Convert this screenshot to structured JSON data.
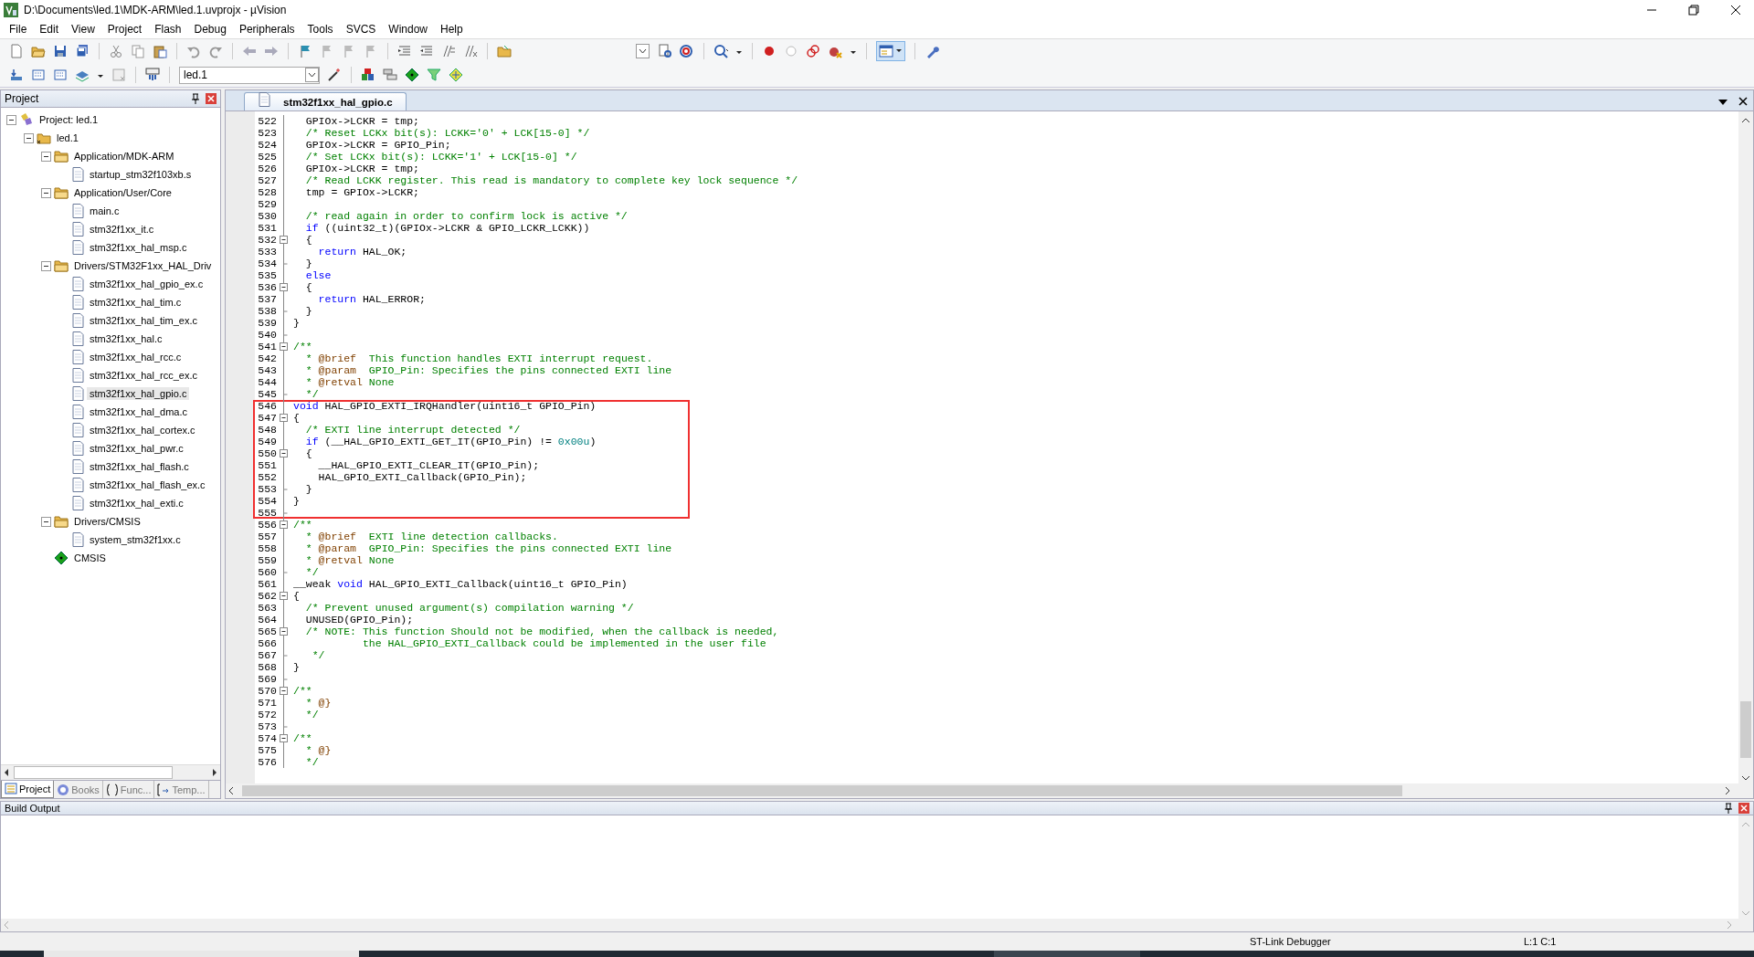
{
  "window": {
    "title": "D:\\Documents\\led.1\\MDK-ARM\\led.1.uvprojx - µVision"
  },
  "menu": [
    "File",
    "Edit",
    "View",
    "Project",
    "Flash",
    "Debug",
    "Peripherals",
    "Tools",
    "SVCS",
    "Window",
    "Help"
  ],
  "target_toolbar": {
    "target": "led.1"
  },
  "project_panel": {
    "title": "Project",
    "tree": [
      {
        "label": "Project: led.1",
        "kind": "project",
        "expanded": true,
        "selected": false,
        "children": [
          {
            "label": "led.1",
            "kind": "target",
            "expanded": true,
            "selected": false,
            "children": [
              {
                "label": "Application/MDK-ARM",
                "kind": "group",
                "expanded": true,
                "selected": false,
                "children": [
                  {
                    "label": "startup_stm32f103xb.s",
                    "kind": "file",
                    "selected": false
                  }
                ]
              },
              {
                "label": "Application/User/Core",
                "kind": "group",
                "expanded": true,
                "selected": false,
                "children": [
                  {
                    "label": "main.c",
                    "kind": "file",
                    "selected": false
                  },
                  {
                    "label": "stm32f1xx_it.c",
                    "kind": "file",
                    "selected": false
                  },
                  {
                    "label": "stm32f1xx_hal_msp.c",
                    "kind": "file",
                    "selected": false
                  }
                ]
              },
              {
                "label": "Drivers/STM32F1xx_HAL_Driv",
                "kind": "group",
                "expanded": true,
                "selected": false,
                "children": [
                  {
                    "label": "stm32f1xx_hal_gpio_ex.c",
                    "kind": "file",
                    "selected": false
                  },
                  {
                    "label": "stm32f1xx_hal_tim.c",
                    "kind": "file",
                    "selected": false
                  },
                  {
                    "label": "stm32f1xx_hal_tim_ex.c",
                    "kind": "file",
                    "selected": false
                  },
                  {
                    "label": "stm32f1xx_hal.c",
                    "kind": "file",
                    "selected": false
                  },
                  {
                    "label": "stm32f1xx_hal_rcc.c",
                    "kind": "file",
                    "selected": false
                  },
                  {
                    "label": "stm32f1xx_hal_rcc_ex.c",
                    "kind": "file",
                    "selected": false
                  },
                  {
                    "label": "stm32f1xx_hal_gpio.c",
                    "kind": "file",
                    "selected": true
                  },
                  {
                    "label": "stm32f1xx_hal_dma.c",
                    "kind": "file",
                    "selected": false
                  },
                  {
                    "label": "stm32f1xx_hal_cortex.c",
                    "kind": "file",
                    "selected": false
                  },
                  {
                    "label": "stm32f1xx_hal_pwr.c",
                    "kind": "file",
                    "selected": false
                  },
                  {
                    "label": "stm32f1xx_hal_flash.c",
                    "kind": "file",
                    "selected": false
                  },
                  {
                    "label": "stm32f1xx_hal_flash_ex.c",
                    "kind": "file",
                    "selected": false
                  },
                  {
                    "label": "stm32f1xx_hal_exti.c",
                    "kind": "file",
                    "selected": false
                  }
                ]
              },
              {
                "label": "Drivers/CMSIS",
                "kind": "group",
                "expanded": true,
                "selected": false,
                "children": [
                  {
                    "label": "system_stm32f1xx.c",
                    "kind": "file",
                    "selected": false
                  }
                ]
              },
              {
                "label": "CMSIS",
                "kind": "component",
                "selected": false
              }
            ]
          }
        ]
      }
    ],
    "tabs": [
      {
        "label": "Project",
        "selected": true
      },
      {
        "label": "Books",
        "selected": false
      },
      {
        "label": "Func...",
        "selected": false
      },
      {
        "label": "Temp...",
        "selected": false
      }
    ]
  },
  "editor": {
    "tabs": [
      {
        "label": "stm32f1xx_hal_gpio.c",
        "selected": true
      }
    ],
    "lines": [
      {
        "number": "522",
        "collapsible": false,
        "block_end": false,
        "highlighted": false,
        "tokens": [
          {
            "kind": "code",
            "text": "  GPIOx->LCKR = tmp;"
          }
        ]
      },
      {
        "number": "523",
        "collapsible": false,
        "block_end": false,
        "highlighted": false,
        "tokens": [
          {
            "kind": "comment",
            "text": "  /* Reset LCKx bit(s): LCKK='0' + LCK[15-0] */"
          }
        ]
      },
      {
        "number": "524",
        "collapsible": false,
        "block_end": false,
        "highlighted": false,
        "tokens": [
          {
            "kind": "code",
            "text": "  GPIOx->LCKR = GPIO_Pin;"
          }
        ]
      },
      {
        "number": "525",
        "collapsible": false,
        "block_end": false,
        "highlighted": false,
        "tokens": [
          {
            "kind": "comment",
            "text": "  /* Set LCKx bit(s): LCKK='1' + LCK[15-0] */"
          }
        ]
      },
      {
        "number": "526",
        "collapsible": false,
        "block_end": false,
        "highlighted": false,
        "tokens": [
          {
            "kind": "code",
            "text": "  GPIOx->LCKR = tmp;"
          }
        ]
      },
      {
        "number": "527",
        "collapsible": false,
        "block_end": false,
        "highlighted": false,
        "tokens": [
          {
            "kind": "comment",
            "text": "  /* Read LCKK register. This read is mandatory to complete key lock sequence */"
          }
        ]
      },
      {
        "number": "528",
        "collapsible": false,
        "block_end": false,
        "highlighted": false,
        "tokens": [
          {
            "kind": "code",
            "text": "  tmp = GPIOx->LCKR;"
          }
        ]
      },
      {
        "number": "529",
        "collapsible": false,
        "block_end": false,
        "highlighted": false
      },
      {
        "number": "530",
        "collapsible": false,
        "block_end": false,
        "highlighted": false,
        "tokens": [
          {
            "kind": "comment",
            "text": "  /* read again in order to confirm lock is active */"
          }
        ]
      },
      {
        "number": "531",
        "collapsible": false,
        "block_end": false,
        "highlighted": false,
        "tokens": [
          {
            "kind": "keyword",
            "text": "  if"
          },
          {
            "kind": "code",
            "text": " ((uint32_t)(GPIOx->LCKR & GPIO_LCKR_LCKK))"
          }
        ]
      },
      {
        "number": "532",
        "collapsible": true,
        "block_end": false,
        "highlighted": false,
        "tokens": [
          {
            "kind": "code",
            "text": "  {"
          }
        ]
      },
      {
        "number": "533",
        "collapsible": false,
        "block_end": false,
        "highlighted": false,
        "tokens": [
          {
            "kind": "keyword",
            "text": "    return"
          },
          {
            "kind": "code",
            "text": " HAL_OK;"
          }
        ]
      },
      {
        "number": "534",
        "collapsible": false,
        "block_end": true,
        "highlighted": false,
        "tokens": [
          {
            "kind": "code",
            "text": "  }"
          }
        ]
      },
      {
        "number": "535",
        "collapsible": false,
        "block_end": false,
        "highlighted": false,
        "tokens": [
          {
            "kind": "keyword",
            "text": "  else"
          }
        ]
      },
      {
        "number": "536",
        "collapsible": true,
        "block_end": false,
        "highlighted": false,
        "tokens": [
          {
            "kind": "code",
            "text": "  {"
          }
        ]
      },
      {
        "number": "537",
        "collapsible": false,
        "block_end": false,
        "highlighted": false,
        "tokens": [
          {
            "kind": "keyword",
            "text": "    return"
          },
          {
            "kind": "code",
            "text": " HAL_ERROR;"
          }
        ]
      },
      {
        "number": "538",
        "collapsible": false,
        "block_end": true,
        "highlighted": false,
        "tokens": [
          {
            "kind": "code",
            "text": "  }"
          }
        ]
      },
      {
        "number": "539",
        "collapsible": false,
        "block_end": false,
        "highlighted": false,
        "tokens": [
          {
            "kind": "code",
            "text": "}"
          }
        ]
      },
      {
        "number": "540",
        "collapsible": false,
        "block_end": true,
        "highlighted": false
      },
      {
        "number": "541",
        "collapsible": true,
        "block_end": false,
        "highlighted": false,
        "tokens": [
          {
            "kind": "comment",
            "text": "/**"
          }
        ]
      },
      {
        "number": "542",
        "collapsible": false,
        "block_end": false,
        "highlighted": false,
        "tokens": [
          {
            "kind": "comment",
            "text": "  * "
          },
          {
            "kind": "tag",
            "text": "@brief"
          },
          {
            "kind": "comment",
            "text": "  This function handles EXTI interrupt request."
          }
        ]
      },
      {
        "number": "543",
        "collapsible": false,
        "block_end": false,
        "highlighted": false,
        "tokens": [
          {
            "kind": "comment",
            "text": "  * "
          },
          {
            "kind": "tag",
            "text": "@param"
          },
          {
            "kind": "comment",
            "text": "  GPIO_Pin: Specifies the pins connected EXTI line"
          }
        ]
      },
      {
        "number": "544",
        "collapsible": false,
        "block_end": false,
        "highlighted": false,
        "tokens": [
          {
            "kind": "comment",
            "text": "  * "
          },
          {
            "kind": "tag",
            "text": "@retval"
          },
          {
            "kind": "comment",
            "text": " None"
          }
        ]
      },
      {
        "number": "545",
        "collapsible": false,
        "block_end": true,
        "highlighted": false,
        "tokens": [
          {
            "kind": "comment",
            "text": "  */"
          }
        ]
      },
      {
        "number": "546",
        "collapsible": false,
        "block_end": false,
        "highlighted": true,
        "tokens": [
          {
            "kind": "keyword",
            "text": "void"
          },
          {
            "kind": "code",
            "text": " HAL_GPIO_EXTI_IRQHandler(uint16_t GPIO_Pin)"
          }
        ]
      },
      {
        "number": "547",
        "collapsible": true,
        "block_end": false,
        "highlighted": true,
        "tokens": [
          {
            "kind": "code",
            "text": "{"
          }
        ]
      },
      {
        "number": "548",
        "collapsible": false,
        "block_end": false,
        "highlighted": true,
        "tokens": [
          {
            "kind": "comment",
            "text": "  /* EXTI line interrupt detected */"
          }
        ]
      },
      {
        "number": "549",
        "collapsible": false,
        "block_end": false,
        "highlighted": true,
        "tokens": [
          {
            "kind": "keyword",
            "text": "  if"
          },
          {
            "kind": "code",
            "text": " (__HAL_GPIO_EXTI_GET_IT(GPIO_Pin) != "
          },
          {
            "kind": "number",
            "text": "0x00u"
          },
          {
            "kind": "code",
            "text": ")"
          }
        ]
      },
      {
        "number": "550",
        "collapsible": true,
        "block_end": false,
        "highlighted": true,
        "tokens": [
          {
            "kind": "code",
            "text": "  {"
          }
        ]
      },
      {
        "number": "551",
        "collapsible": false,
        "block_end": false,
        "highlighted": true,
        "tokens": [
          {
            "kind": "code",
            "text": "    __HAL_GPIO_EXTI_CLEAR_IT(GPIO_Pin);"
          }
        ]
      },
      {
        "number": "552",
        "collapsible": false,
        "block_end": false,
        "highlighted": true,
        "tokens": [
          {
            "kind": "code",
            "text": "    HAL_GPIO_EXTI_Callback(GPIO_Pin);"
          }
        ]
      },
      {
        "number": "553",
        "collapsible": false,
        "block_end": true,
        "highlighted": true,
        "tokens": [
          {
            "kind": "code",
            "text": "  }"
          }
        ]
      },
      {
        "number": "554",
        "collapsible": false,
        "block_end": false,
        "highlighted": true,
        "tokens": [
          {
            "kind": "code",
            "text": "}"
          }
        ]
      },
      {
        "number": "555",
        "collapsible": false,
        "block_end": true,
        "highlighted": true
      },
      {
        "number": "556",
        "collapsible": true,
        "block_end": false,
        "highlighted": false,
        "tokens": [
          {
            "kind": "comment",
            "text": "/**"
          }
        ]
      },
      {
        "number": "557",
        "collapsible": false,
        "block_end": false,
        "highlighted": false,
        "tokens": [
          {
            "kind": "comment",
            "text": "  * "
          },
          {
            "kind": "tag",
            "text": "@brief"
          },
          {
            "kind": "comment",
            "text": "  EXTI line detection callbacks."
          }
        ]
      },
      {
        "number": "558",
        "collapsible": false,
        "block_end": false,
        "highlighted": false,
        "tokens": [
          {
            "kind": "comment",
            "text": "  * "
          },
          {
            "kind": "tag",
            "text": "@param"
          },
          {
            "kind": "comment",
            "text": "  GPIO_Pin: Specifies the pins connected EXTI line"
          }
        ]
      },
      {
        "number": "559",
        "collapsible": false,
        "block_end": false,
        "highlighted": false,
        "tokens": [
          {
            "kind": "comment",
            "text": "  * "
          },
          {
            "kind": "tag",
            "text": "@retval"
          },
          {
            "kind": "comment",
            "text": " None"
          }
        ]
      },
      {
        "number": "560",
        "collapsible": false,
        "block_end": true,
        "highlighted": false,
        "tokens": [
          {
            "kind": "comment",
            "text": "  */"
          }
        ]
      },
      {
        "number": "561",
        "collapsible": false,
        "block_end": false,
        "highlighted": false,
        "tokens": [
          {
            "kind": "code",
            "text": "__weak "
          },
          {
            "kind": "keyword",
            "text": "void"
          },
          {
            "kind": "code",
            "text": " HAL_GPIO_EXTI_Callback(uint16_t GPIO_Pin)"
          }
        ]
      },
      {
        "number": "562",
        "collapsible": true,
        "block_end": false,
        "highlighted": false,
        "tokens": [
          {
            "kind": "code",
            "text": "{"
          }
        ]
      },
      {
        "number": "563",
        "collapsible": false,
        "block_end": false,
        "highlighted": false,
        "tokens": [
          {
            "kind": "comment",
            "text": "  /* Prevent unused argument(s) compilation warning */"
          }
        ]
      },
      {
        "number": "564",
        "collapsible": false,
        "block_end": false,
        "highlighted": false,
        "tokens": [
          {
            "kind": "code",
            "text": "  UNUSED(GPIO_Pin);"
          }
        ]
      },
      {
        "number": "565",
        "collapsible": true,
        "block_end": false,
        "highlighted": false,
        "tokens": [
          {
            "kind": "comment",
            "text": "  /* NOTE: This function Should not be modified, when the callback is needed,"
          }
        ]
      },
      {
        "number": "566",
        "collapsible": false,
        "block_end": false,
        "highlighted": false,
        "tokens": [
          {
            "kind": "comment",
            "text": "           the HAL_GPIO_EXTI_Callback could be implemented in the user file"
          }
        ]
      },
      {
        "number": "567",
        "collapsible": false,
        "block_end": true,
        "highlighted": false,
        "tokens": [
          {
            "kind": "comment",
            "text": "   */"
          }
        ]
      },
      {
        "number": "568",
        "collapsible": false,
        "block_end": false,
        "highlighted": false,
        "tokens": [
          {
            "kind": "code",
            "text": "}"
          }
        ]
      },
      {
        "number": "569",
        "collapsible": false,
        "block_end": true,
        "highlighted": false
      },
      {
        "number": "570",
        "collapsible": true,
        "block_end": false,
        "highlighted": false,
        "tokens": [
          {
            "kind": "comment",
            "text": "/**"
          }
        ]
      },
      {
        "number": "571",
        "collapsible": false,
        "block_end": false,
        "highlighted": false,
        "tokens": [
          {
            "kind": "comment",
            "text": "  * "
          },
          {
            "kind": "tag",
            "text": "@}"
          }
        ]
      },
      {
        "number": "572",
        "collapsible": false,
        "block_end": false,
        "highlighted": false,
        "tokens": [
          {
            "kind": "comment",
            "text": "  */"
          }
        ]
      },
      {
        "number": "573",
        "collapsible": false,
        "block_end": true,
        "highlighted": false
      },
      {
        "number": "574",
        "collapsible": true,
        "block_end": false,
        "highlighted": false,
        "tokens": [
          {
            "kind": "comment",
            "text": "/**"
          }
        ]
      },
      {
        "number": "575",
        "collapsible": false,
        "block_end": false,
        "highlighted": false,
        "tokens": [
          {
            "kind": "comment",
            "text": "  * "
          },
          {
            "kind": "tag",
            "text": "@}"
          }
        ]
      },
      {
        "number": "576",
        "collapsible": false,
        "block_end": false,
        "highlighted": false,
        "tokens": [
          {
            "kind": "comment",
            "text": "  */"
          }
        ]
      }
    ]
  },
  "build_output": {
    "title": "Build Output"
  },
  "status_bar": {
    "debugger": "ST-Link Debugger",
    "cursor": "L:1 C:1"
  }
}
